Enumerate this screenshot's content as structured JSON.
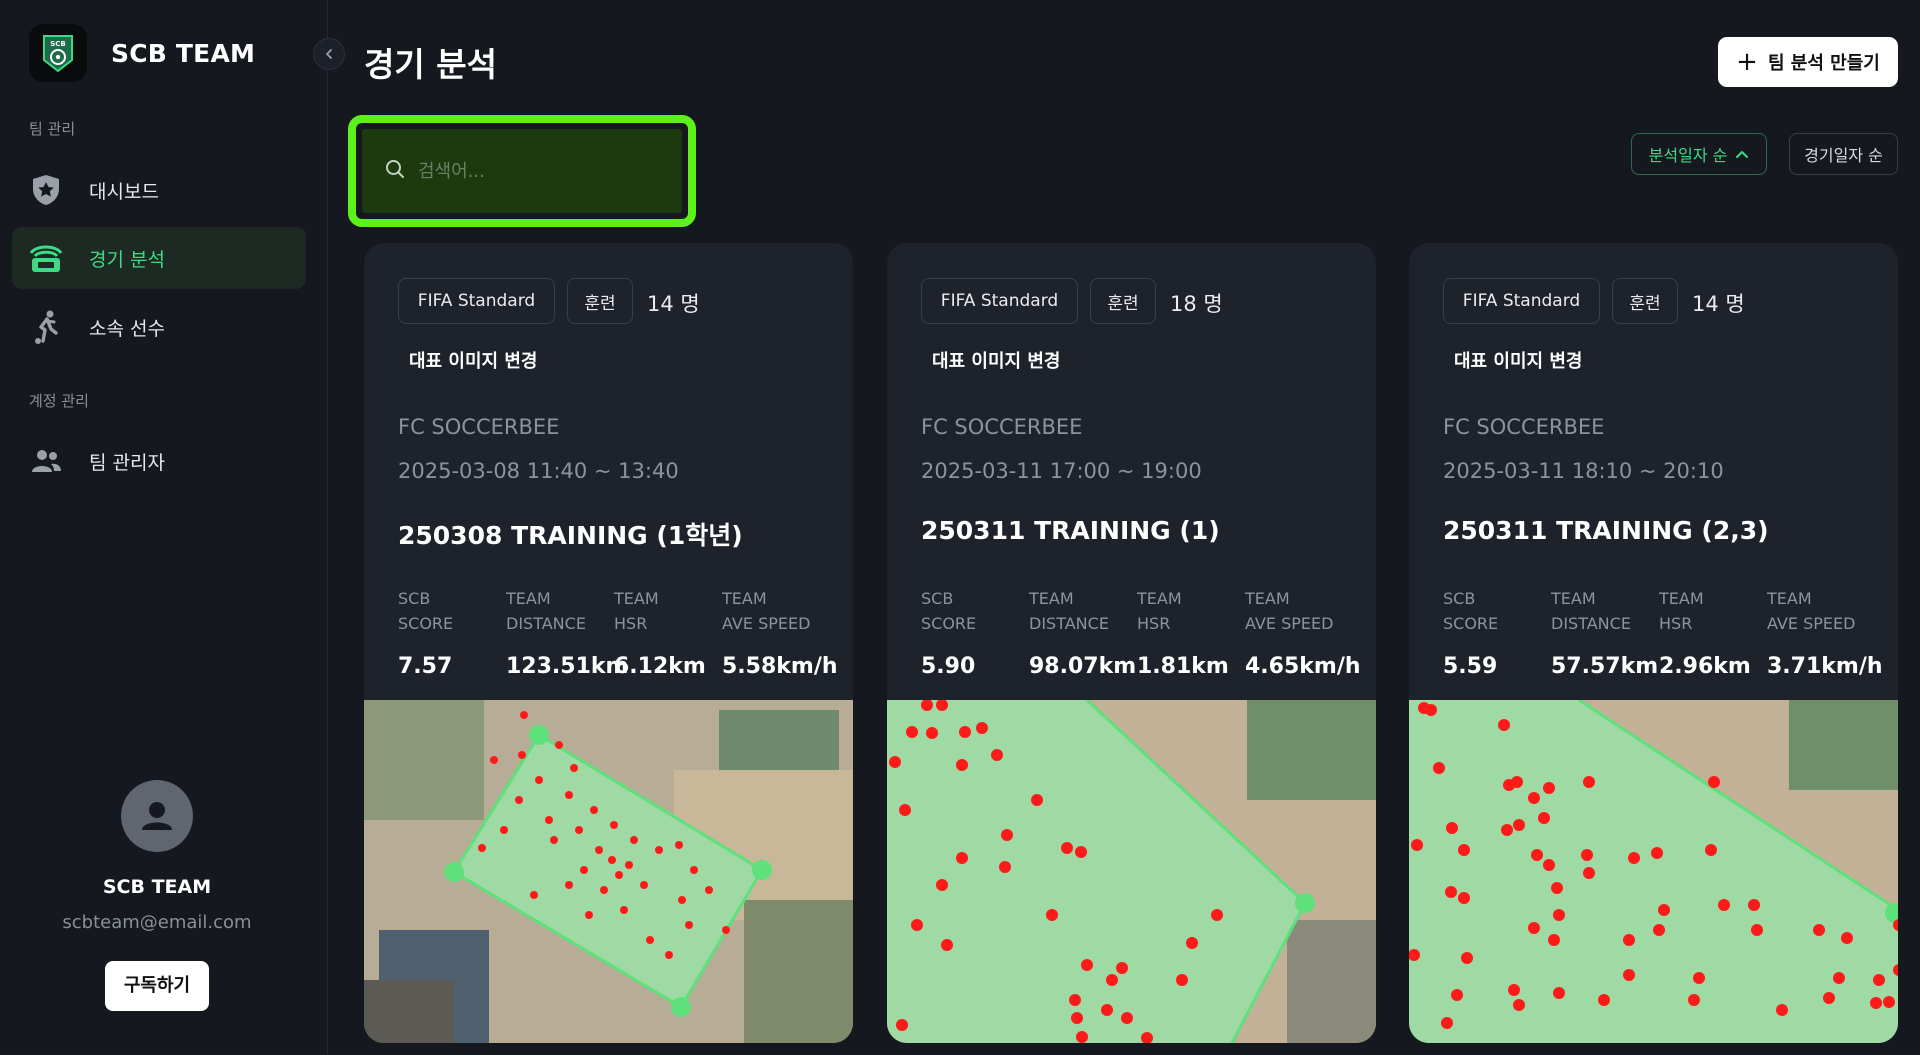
{
  "sidebar": {
    "brand_name": "SCB TEAM",
    "brand_logo_text": "SCB",
    "sections": [
      {
        "label": "팀 관리"
      },
      {
        "label": "계정 관리"
      }
    ],
    "items": [
      {
        "label": "대시보드",
        "icon": "shield-star-icon"
      },
      {
        "label": "경기 분석",
        "icon": "stadium-icon",
        "active": true
      },
      {
        "label": "소속 선수",
        "icon": "player-kick-icon"
      },
      {
        "label": "팀 관리자",
        "icon": "users-icon"
      }
    ],
    "profile": {
      "name": "SCB TEAM",
      "email": "scbteam@email.com",
      "subscribe_label": "구독하기"
    }
  },
  "header": {
    "title": "경기 분석",
    "create_label": "팀 분석 만들기"
  },
  "search": {
    "placeholder": "검색어...",
    "value": ""
  },
  "sort": {
    "options": [
      {
        "label": "분석일자 순",
        "active": true,
        "direction": "ascending"
      },
      {
        "label": "경기일자 순",
        "active": false
      }
    ]
  },
  "stat_labels": [
    "SCB\nSCORE",
    "TEAM\nDISTANCE",
    "TEAM\nHSR",
    "TEAM\nAVE SPEED"
  ],
  "cards": [
    {
      "standard": "FIFA Standard",
      "kind": "훈련",
      "players": "14 명",
      "change_image_label": "대표 이미지 변경",
      "team": "FC SOCCERBEE",
      "date": "2025-03-08 11:40 ~ 13:40",
      "title": "250308 TRAINING (1학년)",
      "stats": [
        "7.57",
        "123.51km",
        "6.12km",
        "5.58km/h"
      ]
    },
    {
      "standard": "FIFA Standard",
      "kind": "훈련",
      "players": "18 명",
      "change_image_label": "대표 이미지 변경",
      "team": "FC SOCCERBEE",
      "date": "2025-03-11 17:00 ~ 19:00",
      "title": "250311 TRAINING (1)",
      "stats": [
        "5.90",
        "98.07km",
        "1.81km",
        "4.65km/h"
      ]
    },
    {
      "standard": "FIFA Standard",
      "kind": "훈련",
      "players": "14 명",
      "change_image_label": "대표 이미지 변경",
      "team": "FC SOCCERBEE",
      "date": "2025-03-11 18:10 ~ 20:10",
      "title": "250311 TRAINING (2,3)",
      "stats": [
        "5.59",
        "57.57km",
        "2.96km",
        "3.71km/h"
      ]
    }
  ],
  "colors": {
    "accent": "#3ddc84",
    "highlight": "#5cf219",
    "field": "#9fd9a3",
    "dot": "#ff1a1a"
  }
}
